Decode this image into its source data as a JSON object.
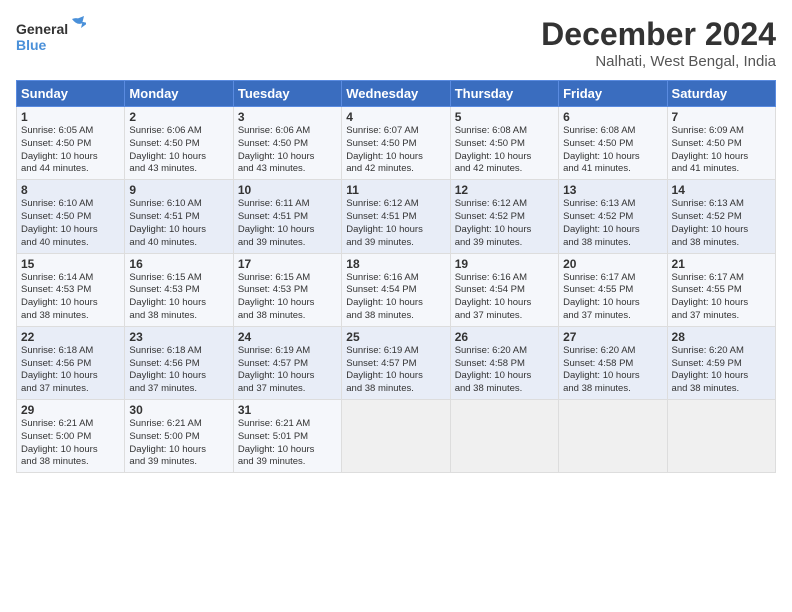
{
  "logo": {
    "line1": "General",
    "line2": "Blue"
  },
  "title": "December 2024",
  "location": "Nalhati, West Bengal, India",
  "weekdays": [
    "Sunday",
    "Monday",
    "Tuesday",
    "Wednesday",
    "Thursday",
    "Friday",
    "Saturday"
  ],
  "weeks": [
    [
      {
        "day": "1",
        "info": "Sunrise: 6:05 AM\nSunset: 4:50 PM\nDaylight: 10 hours\nand 44 minutes."
      },
      {
        "day": "2",
        "info": "Sunrise: 6:06 AM\nSunset: 4:50 PM\nDaylight: 10 hours\nand 43 minutes."
      },
      {
        "day": "3",
        "info": "Sunrise: 6:06 AM\nSunset: 4:50 PM\nDaylight: 10 hours\nand 43 minutes."
      },
      {
        "day": "4",
        "info": "Sunrise: 6:07 AM\nSunset: 4:50 PM\nDaylight: 10 hours\nand 42 minutes."
      },
      {
        "day": "5",
        "info": "Sunrise: 6:08 AM\nSunset: 4:50 PM\nDaylight: 10 hours\nand 42 minutes."
      },
      {
        "day": "6",
        "info": "Sunrise: 6:08 AM\nSunset: 4:50 PM\nDaylight: 10 hours\nand 41 minutes."
      },
      {
        "day": "7",
        "info": "Sunrise: 6:09 AM\nSunset: 4:50 PM\nDaylight: 10 hours\nand 41 minutes."
      }
    ],
    [
      {
        "day": "8",
        "info": "Sunrise: 6:10 AM\nSunset: 4:50 PM\nDaylight: 10 hours\nand 40 minutes."
      },
      {
        "day": "9",
        "info": "Sunrise: 6:10 AM\nSunset: 4:51 PM\nDaylight: 10 hours\nand 40 minutes."
      },
      {
        "day": "10",
        "info": "Sunrise: 6:11 AM\nSunset: 4:51 PM\nDaylight: 10 hours\nand 39 minutes."
      },
      {
        "day": "11",
        "info": "Sunrise: 6:12 AM\nSunset: 4:51 PM\nDaylight: 10 hours\nand 39 minutes."
      },
      {
        "day": "12",
        "info": "Sunrise: 6:12 AM\nSunset: 4:52 PM\nDaylight: 10 hours\nand 39 minutes."
      },
      {
        "day": "13",
        "info": "Sunrise: 6:13 AM\nSunset: 4:52 PM\nDaylight: 10 hours\nand 38 minutes."
      },
      {
        "day": "14",
        "info": "Sunrise: 6:13 AM\nSunset: 4:52 PM\nDaylight: 10 hours\nand 38 minutes."
      }
    ],
    [
      {
        "day": "15",
        "info": "Sunrise: 6:14 AM\nSunset: 4:53 PM\nDaylight: 10 hours\nand 38 minutes."
      },
      {
        "day": "16",
        "info": "Sunrise: 6:15 AM\nSunset: 4:53 PM\nDaylight: 10 hours\nand 38 minutes."
      },
      {
        "day": "17",
        "info": "Sunrise: 6:15 AM\nSunset: 4:53 PM\nDaylight: 10 hours\nand 38 minutes."
      },
      {
        "day": "18",
        "info": "Sunrise: 6:16 AM\nSunset: 4:54 PM\nDaylight: 10 hours\nand 38 minutes."
      },
      {
        "day": "19",
        "info": "Sunrise: 6:16 AM\nSunset: 4:54 PM\nDaylight: 10 hours\nand 37 minutes."
      },
      {
        "day": "20",
        "info": "Sunrise: 6:17 AM\nSunset: 4:55 PM\nDaylight: 10 hours\nand 37 minutes."
      },
      {
        "day": "21",
        "info": "Sunrise: 6:17 AM\nSunset: 4:55 PM\nDaylight: 10 hours\nand 37 minutes."
      }
    ],
    [
      {
        "day": "22",
        "info": "Sunrise: 6:18 AM\nSunset: 4:56 PM\nDaylight: 10 hours\nand 37 minutes."
      },
      {
        "day": "23",
        "info": "Sunrise: 6:18 AM\nSunset: 4:56 PM\nDaylight: 10 hours\nand 37 minutes."
      },
      {
        "day": "24",
        "info": "Sunrise: 6:19 AM\nSunset: 4:57 PM\nDaylight: 10 hours\nand 37 minutes."
      },
      {
        "day": "25",
        "info": "Sunrise: 6:19 AM\nSunset: 4:57 PM\nDaylight: 10 hours\nand 38 minutes."
      },
      {
        "day": "26",
        "info": "Sunrise: 6:20 AM\nSunset: 4:58 PM\nDaylight: 10 hours\nand 38 minutes."
      },
      {
        "day": "27",
        "info": "Sunrise: 6:20 AM\nSunset: 4:58 PM\nDaylight: 10 hours\nand 38 minutes."
      },
      {
        "day": "28",
        "info": "Sunrise: 6:20 AM\nSunset: 4:59 PM\nDaylight: 10 hours\nand 38 minutes."
      }
    ],
    [
      {
        "day": "29",
        "info": "Sunrise: 6:21 AM\nSunset: 5:00 PM\nDaylight: 10 hours\nand 38 minutes."
      },
      {
        "day": "30",
        "info": "Sunrise: 6:21 AM\nSunset: 5:00 PM\nDaylight: 10 hours\nand 39 minutes."
      },
      {
        "day": "31",
        "info": "Sunrise: 6:21 AM\nSunset: 5:01 PM\nDaylight: 10 hours\nand 39 minutes."
      },
      {
        "day": "",
        "info": ""
      },
      {
        "day": "",
        "info": ""
      },
      {
        "day": "",
        "info": ""
      },
      {
        "day": "",
        "info": ""
      }
    ]
  ]
}
